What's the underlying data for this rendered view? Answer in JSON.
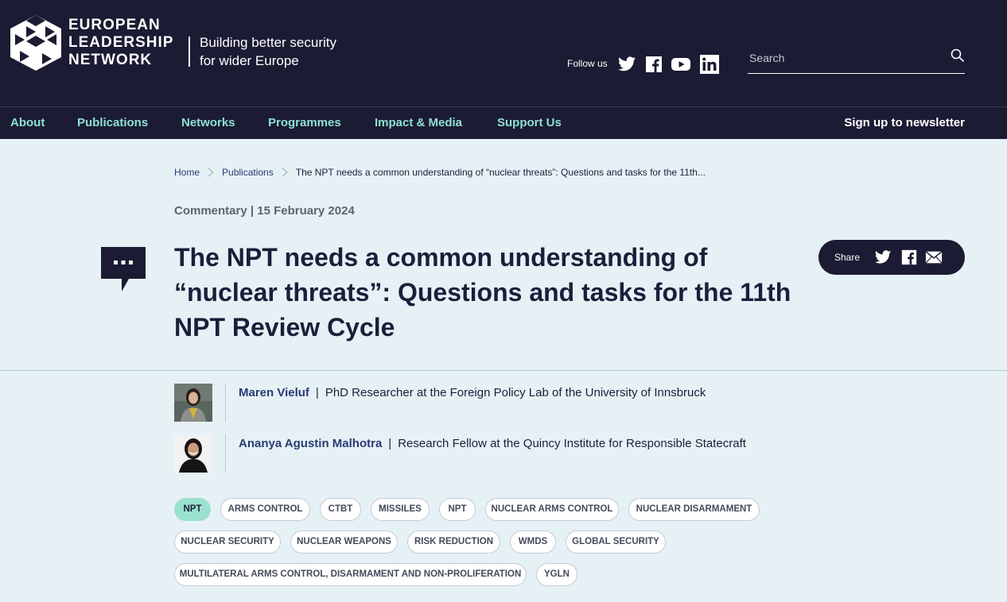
{
  "header": {
    "logo_lines": [
      "EUROPEAN",
      "LEADERSHIP",
      "NETWORK"
    ],
    "tagline_lines": [
      "Building better security",
      "for wider Europe"
    ],
    "follow_label": "Follow us",
    "social_icons": [
      "twitter-icon",
      "facebook-icon",
      "youtube-icon",
      "linkedin-icon"
    ],
    "search": {
      "placeholder": "Search",
      "value": ""
    }
  },
  "nav": {
    "items": [
      "About",
      "Publications",
      "Networks",
      "Programmes",
      "Impact & Media",
      "Support Us"
    ],
    "newsletter": "Sign up to newsletter"
  },
  "breadcrumb": {
    "items": [
      "Home",
      "Publications"
    ],
    "current": "The NPT needs a common understanding of “nuclear threats”: Questions and tasks for the 11th..."
  },
  "article": {
    "meta": "Commentary | 15 February 2024",
    "title": "The NPT needs a common understanding of “nuclear threats”: Questions and tasks for the 11th NPT Review Cycle",
    "share_label": "Share",
    "share_icons": [
      "twitter-icon",
      "facebook-icon",
      "email-icon"
    ]
  },
  "authors": [
    {
      "name": "Maren Vieluf",
      "separator": "|",
      "role": "PhD Researcher at the Foreign Policy Lab of the University of Innsbruck"
    },
    {
      "name": "Ananya Agustin Malhotra",
      "separator": "|",
      "role": "Research Fellow at the Quincy Institute for Responsible Statecraft"
    }
  ],
  "tags": [
    {
      "label": "NPT",
      "active": true
    },
    {
      "label": "ARMS CONTROL",
      "active": false
    },
    {
      "label": "CTBT",
      "active": false
    },
    {
      "label": "MISSILES",
      "active": false
    },
    {
      "label": "NPT",
      "active": false
    },
    {
      "label": "NUCLEAR ARMS CONTROL",
      "active": false
    },
    {
      "label": "NUCLEAR DISARMAMENT",
      "active": false
    },
    {
      "label": "NUCLEAR SECURITY",
      "active": false
    },
    {
      "label": "NUCLEAR WEAPONS",
      "active": false
    },
    {
      "label": "RISK REDUCTION",
      "active": false
    },
    {
      "label": "WMDS",
      "active": false
    },
    {
      "label": "GLOBAL SECURITY",
      "active": false
    },
    {
      "label": "MULTILATERAL ARMS CONTROL, DISARMAMENT AND NON-PROLIFERATION",
      "active": false
    },
    {
      "label": "YGLN",
      "active": false
    }
  ],
  "colors": {
    "header_bg": "#1b1b33",
    "nav_accent": "#8ee0cf",
    "page_bg": "#e6f1f6",
    "active_tag": "#9be1cf",
    "link": "#2a3b74"
  }
}
